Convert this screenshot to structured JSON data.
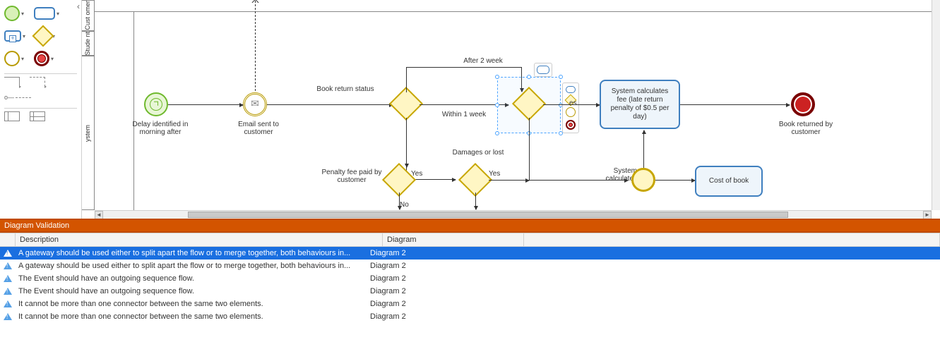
{
  "palette": {
    "items": [
      "start-event",
      "task",
      "subprocess",
      "gateway",
      "intermediate-event",
      "end-event"
    ],
    "connectors": [
      "sequence-flow",
      "message-flow",
      "association"
    ],
    "containers": [
      "pool",
      "lane"
    ]
  },
  "lanes": {
    "cust": "Cust\nomer",
    "stud": "Stude\nnt",
    "sys": "ystem"
  },
  "nodes": {
    "delay": "Delay identified in morning after",
    "email": "Email sent to customer",
    "status": "Book return status",
    "after2w": "After 2 week",
    "within1w": "Within 1 week",
    "damages": "Damages or lost",
    "penalty": "Penalty fee paid by customer",
    "syscalc": "System calculates",
    "calcfee": "System calculates fee (late return penalty of $0.5 per day)",
    "costbook": "Cost of book",
    "returned": "Book returned by customer",
    "yes": "Yes",
    "no": "No",
    "es": "es"
  },
  "ctx_palette": [
    "task-icon",
    "gateway-icon",
    "intermediate-icon",
    "end-icon"
  ],
  "validation": {
    "title": "Diagram Validation",
    "columns": {
      "desc": "Description",
      "diag": "Diagram"
    },
    "rows": [
      {
        "desc": "A gateway should be used either to split apart the flow or to merge together, both behaviours in...",
        "diag": "Diagram 2",
        "sel": true
      },
      {
        "desc": "A gateway should be used either to split apart the flow or to merge together, both behaviours in...",
        "diag": "Diagram 2"
      },
      {
        "desc": "The Event should have an outgoing sequence flow.",
        "diag": "Diagram 2"
      },
      {
        "desc": "The Event should have an outgoing sequence flow.",
        "diag": "Diagram 2"
      },
      {
        "desc": "It cannot be more than one connector between the same two elements.",
        "diag": "Diagram 2"
      },
      {
        "desc": "It cannot be more than one connector between the same two elements.",
        "diag": "Diagram 2"
      }
    ]
  }
}
